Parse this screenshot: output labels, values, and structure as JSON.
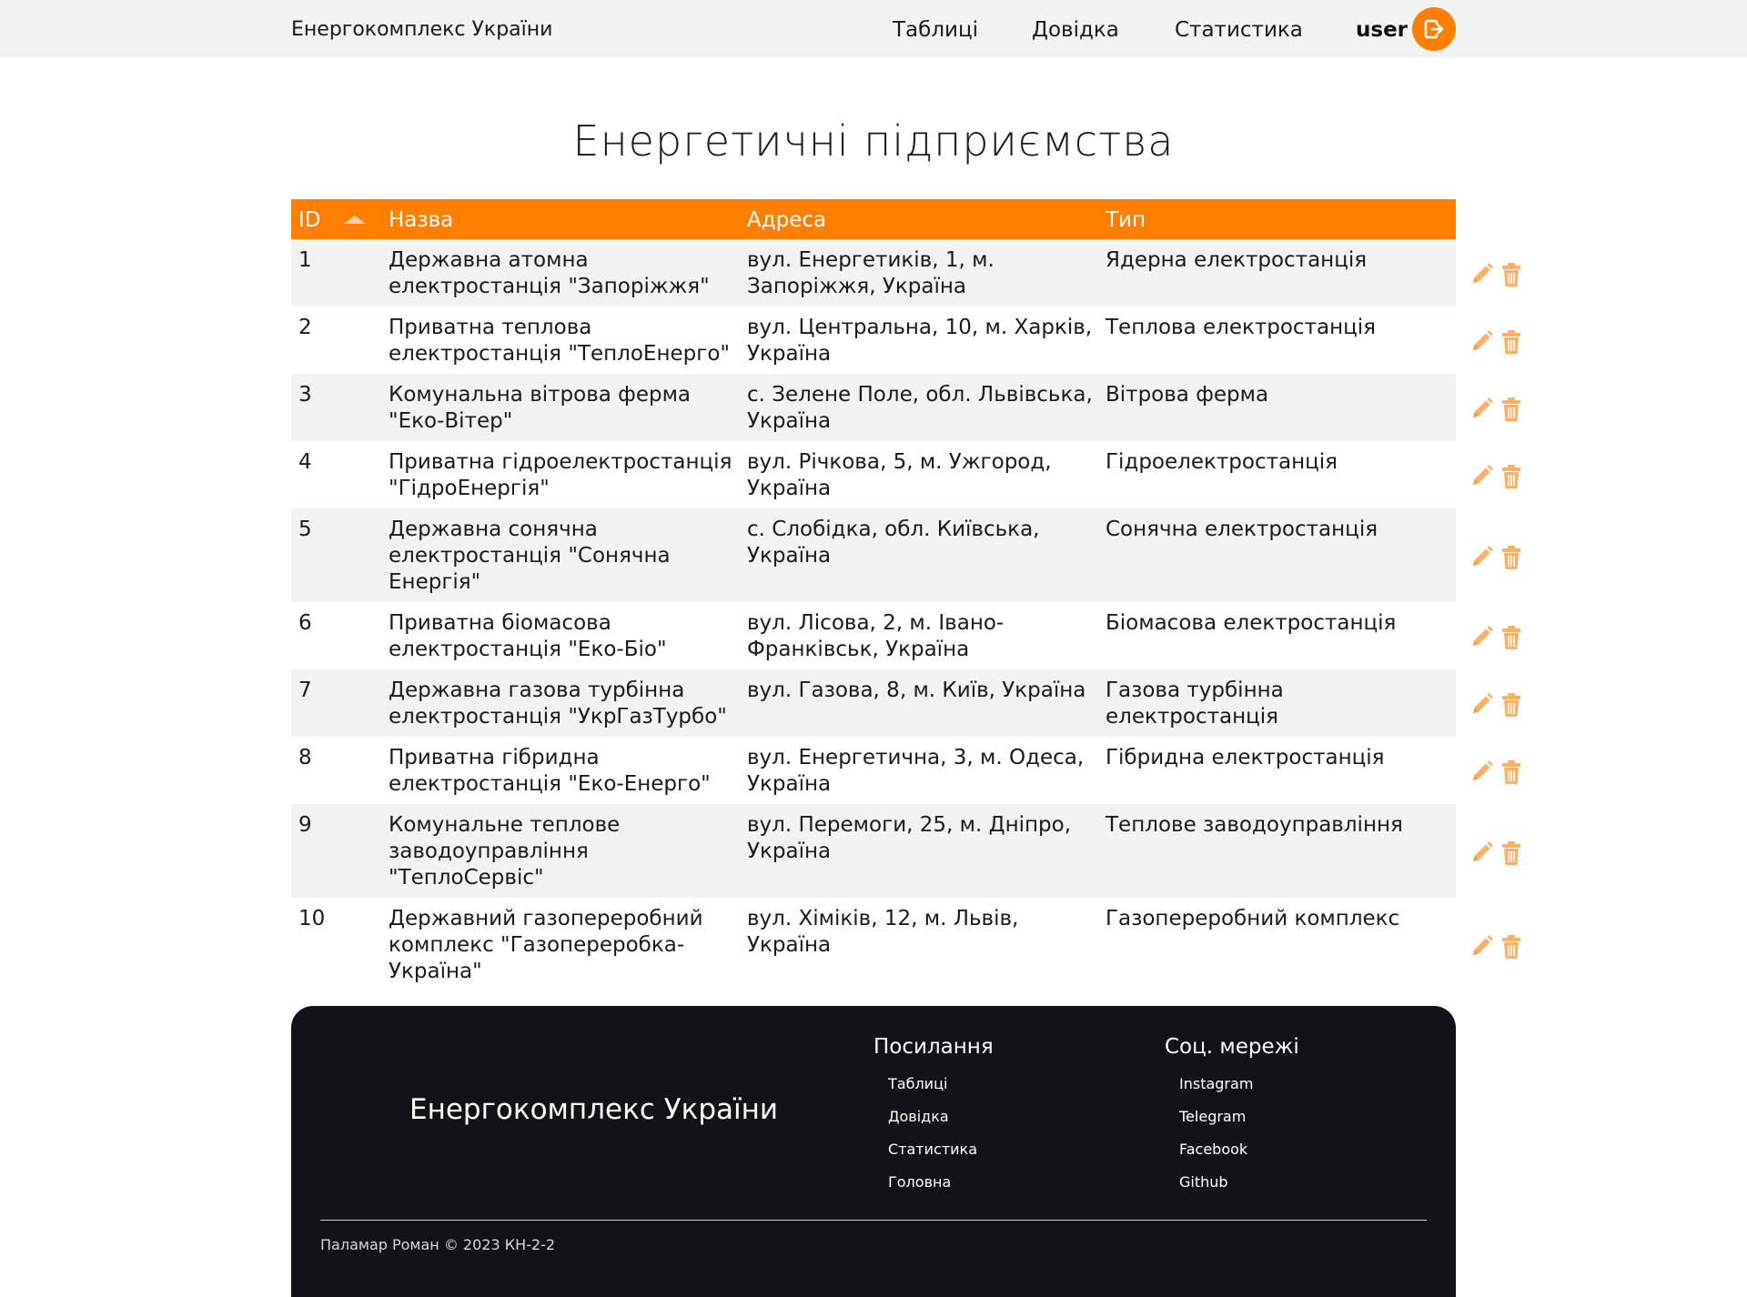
{
  "header": {
    "brand": "Енергокомплекс України",
    "nav": [
      "Таблиці",
      "Довідка",
      "Статистика"
    ],
    "username": "user"
  },
  "page": {
    "title": "Енергетичні підприємства"
  },
  "table": {
    "columns": [
      "ID",
      "Назва",
      "Адреса",
      "Тип"
    ],
    "sort": {
      "column": "ID",
      "direction": "ascending"
    },
    "rows": [
      {
        "id": "1",
        "name": "Державна атомна електростанція \"Запоріжжя\"",
        "address": "вул. Енергетиків, 1, м. Запоріжжя, Україна",
        "type": "Ядерна електростанція"
      },
      {
        "id": "2",
        "name": "Приватна теплова електростанція \"ТеплоЕнерго\"",
        "address": "вул. Центральна, 10, м. Харків, Україна",
        "type": "Теплова електростанція"
      },
      {
        "id": "3",
        "name": "Комунальна вітрова ферма \"Еко-Вітер\"",
        "address": "с. Зелене Поле, обл. Львівська, Україна",
        "type": "Вітрова ферма"
      },
      {
        "id": "4",
        "name": "Приватна гідроелектростанція \"ГідроЕнергія\"",
        "address": "вул. Річкова, 5, м. Ужгород, Україна",
        "type": "Гідроелектростанція"
      },
      {
        "id": "5",
        "name": "Державна сонячна електростанція \"Сонячна Енергія\"",
        "address": "с. Слобідка, обл. Київська, Україна",
        "type": "Сонячна електростанція"
      },
      {
        "id": "6",
        "name": "Приватна біомасова електростанція \"Еко-Біо\"",
        "address": "вул. Лісова, 2, м. Івано-Франківськ, Україна",
        "type": "Біомасова електростанція"
      },
      {
        "id": "7",
        "name": "Державна газова турбінна електростанція \"УкрГазТурбо\"",
        "address": "вул. Газова, 8, м. Київ, Україна",
        "type": "Газова турбінна електростанція"
      },
      {
        "id": "8",
        "name": "Приватна гібридна електростанція \"Еко-Енерго\"",
        "address": "вул. Енергетична, 3, м. Одеса, Україна",
        "type": "Гібридна електростанція"
      },
      {
        "id": "9",
        "name": "Комунальне теплове заводоуправління \"ТеплоСервіс\"",
        "address": "вул. Перемоги, 25, м. Дніпро, Україна",
        "type": "Теплове заводоуправління"
      },
      {
        "id": "10",
        "name": "Державний газопереробний комплекс \"Газопереробка-Україна\"",
        "address": "вул. Хіміків, 12, м. Львів, Україна",
        "type": "Газопереробний комплекс"
      }
    ]
  },
  "footer": {
    "brand": "Енергокомплекс України",
    "links_heading": "Посилання",
    "links": [
      "Таблиці",
      "Довідка",
      "Статистика",
      "Головна"
    ],
    "social_heading": "Соц. мережі",
    "social": [
      "Instagram",
      "Telegram",
      "Facebook",
      "Github"
    ],
    "copyright": "Паламар Роман © 2023 КН-2-2"
  },
  "icons": {
    "logout": "logout-icon",
    "edit": "pencil-icon",
    "delete": "trash-icon",
    "sort": "sort-ascending-icon"
  },
  "colors": {
    "accent": "#ff7f00",
    "header_bg": "#f2f2f2",
    "row_stripe": "#f2f2f2",
    "footer_bg": "#101418",
    "action_icon": "#ffb066"
  }
}
